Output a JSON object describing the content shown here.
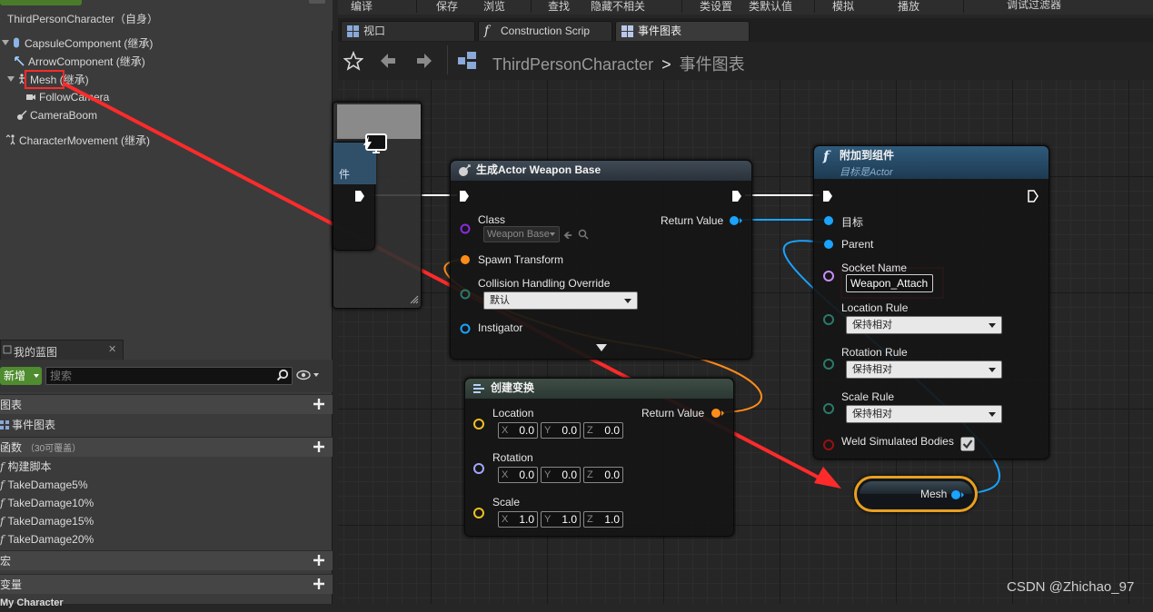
{
  "components": {
    "title": "ThirdPersonCharacter（自身）",
    "items": [
      {
        "label": "CapsuleComponent (继承)"
      },
      {
        "label": "ArrowComponent (继承)"
      },
      {
        "label": "Mesh (继承)"
      },
      {
        "label": "FollowCamera"
      },
      {
        "label": "CameraBoom"
      },
      {
        "label": "CharacterMovement (继承)"
      }
    ]
  },
  "myblueprint": {
    "tab_label": "我的蓝图",
    "new_label": "新增",
    "search_placeholder": "搜索",
    "sections": [
      {
        "label": "图表"
      },
      {
        "label": "函数",
        "sub": "（30可覆盖）"
      },
      {
        "label": "宏"
      },
      {
        "label": "变量"
      }
    ],
    "graph_items": [
      {
        "label": "事件图表"
      }
    ],
    "function_items": [
      {
        "label": "构建脚本"
      },
      {
        "label": "TakeDamage5%"
      },
      {
        "label": "TakeDamage10%"
      },
      {
        "label": "TakeDamage15%"
      },
      {
        "label": "TakeDamage20%"
      }
    ],
    "bottom_cut": "My Character"
  },
  "toolbar": {
    "items": [
      "编译",
      "保存",
      "浏览",
      "查找",
      "隐藏不相关",
      "类设置",
      "类默认值",
      "模拟",
      "播放",
      "调试过滤器"
    ]
  },
  "tabs": [
    {
      "label": "视口"
    },
    {
      "label": "Construction Scrip"
    },
    {
      "label": "事件图表"
    }
  ],
  "breadcrumb": {
    "root": "ThirdPersonCharacter",
    "sep": ">",
    "leaf": "事件图表"
  },
  "spawn_node": {
    "title": "生成Actor Weapon Base",
    "class_label": "Class",
    "class_value": "Weapon Base",
    "return_label": "Return Value",
    "spawn_transform": "Spawn Transform",
    "collision_label": "Collision Handling Override",
    "collision_value": "默认",
    "instigator": "Instigator"
  },
  "transform_node": {
    "title": "创建变换",
    "return_label": "Return Value",
    "location_label": "Location",
    "rotation_label": "Rotation",
    "scale_label": "Scale",
    "location": {
      "x": "0.0",
      "y": "0.0",
      "z": "0.0"
    },
    "rotation": {
      "x": "0.0",
      "y": "0.0",
      "z": "0.0"
    },
    "scale": {
      "x": "1.0",
      "y": "1.0",
      "z": "1.0"
    },
    "axes": {
      "x": "X",
      "y": "Y",
      "z": "Z"
    }
  },
  "attach_node": {
    "title": "附加到组件",
    "subtitle": "目标是Actor",
    "target": "目标",
    "parent": "Parent",
    "socket_label": "Socket Name",
    "socket_value": "Weapon_Attach",
    "location_rule": "Location Rule",
    "rotation_rule": "Rotation Rule",
    "scale_rule": "Scale Rule",
    "rule_value": "保持相对",
    "weld": "Weld Simulated Bodies"
  },
  "mesh_node": {
    "label": "Mesh"
  },
  "partial_node": {
    "label": "件"
  },
  "watermark": "CSDN @Zhichao_97",
  "colors": {
    "exec": "#ffffff",
    "object_pin": "#1aa3ff",
    "struct_pin": "#ff8c1a",
    "class_pin": "#8a2be2",
    "name_pin": "#c98dff",
    "enum_pin": "#2a7a6a",
    "bool_pin": "#9a1010",
    "vector_pin": "#f0c020",
    "rotator_pin": "#a0a8ff",
    "annotation_red": "#ff2b2b",
    "mesh_border": "#e8a020"
  }
}
